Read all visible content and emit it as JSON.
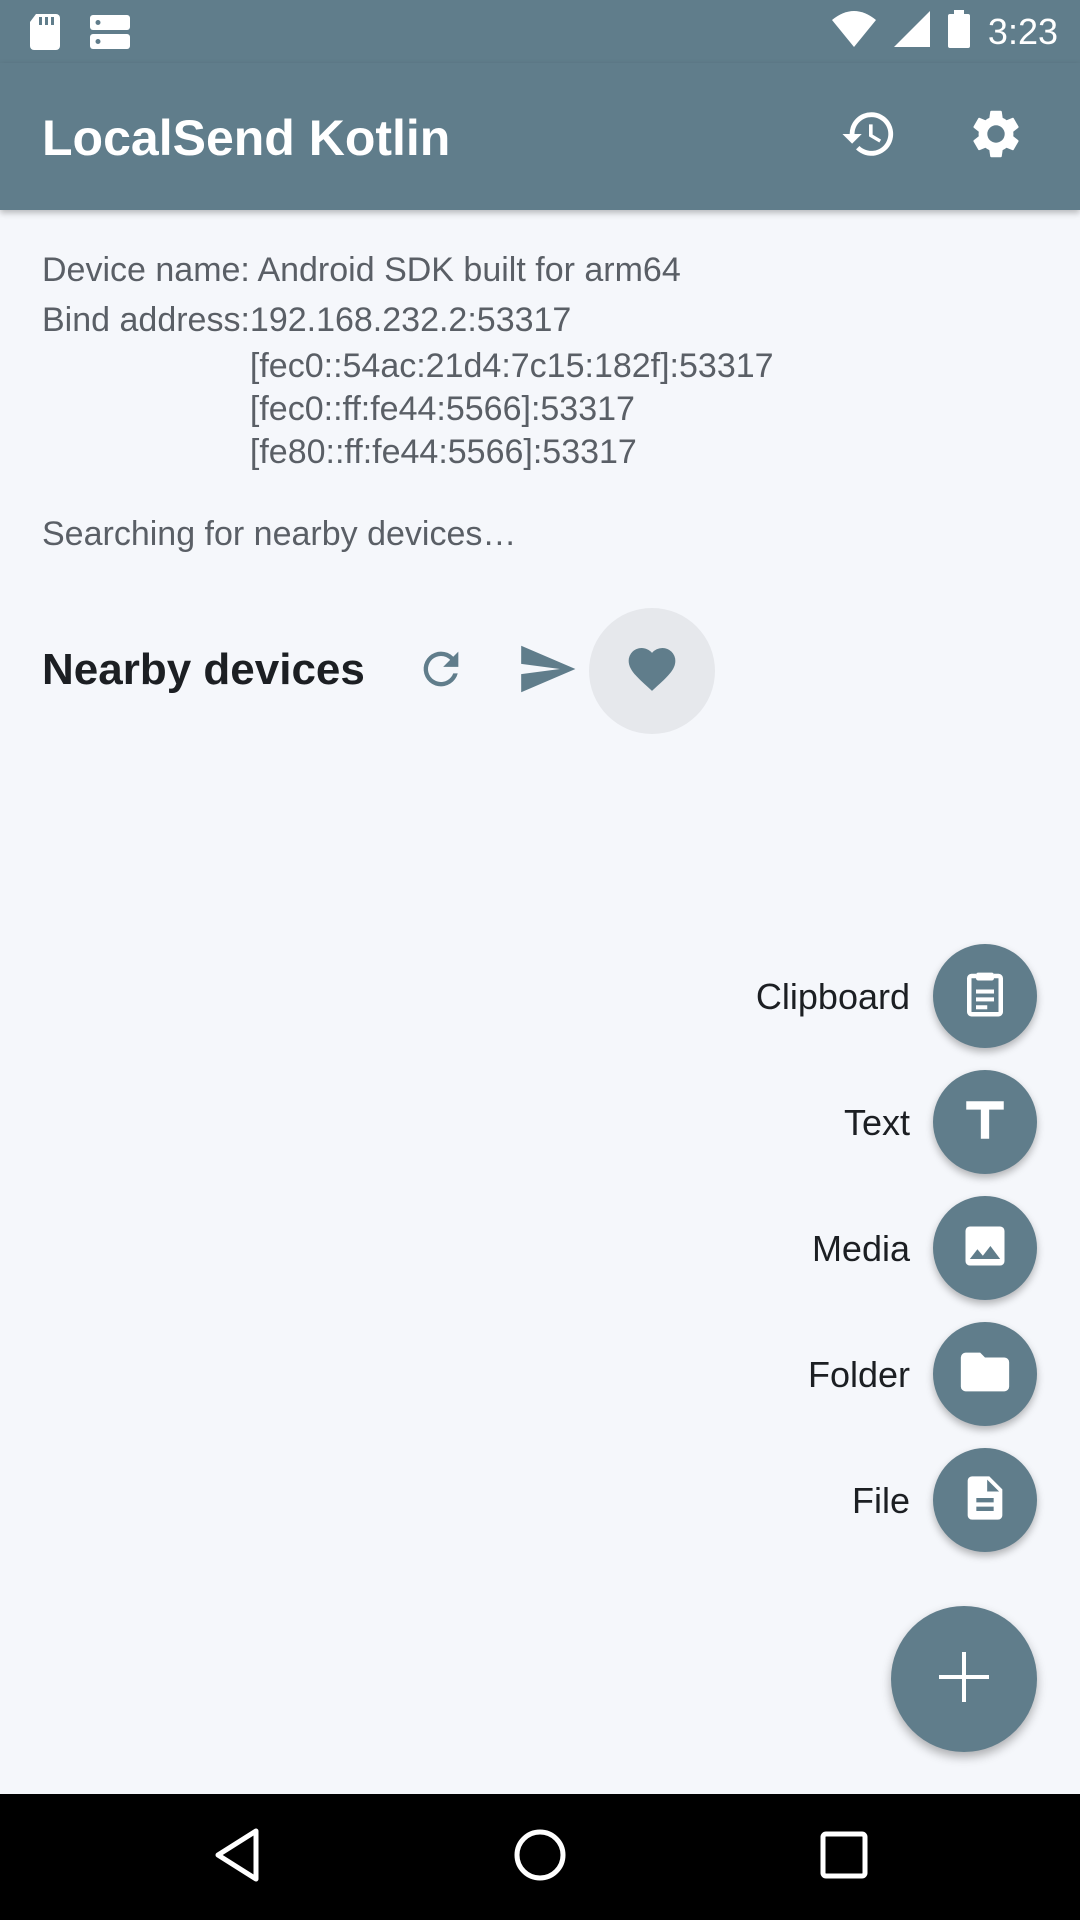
{
  "status_bar": {
    "time": "3:23",
    "icons": [
      "sd-card-icon",
      "storage-icon",
      "wifi-icon",
      "signal-icon",
      "battery-icon"
    ]
  },
  "app_bar": {
    "title": "LocalSend Kotlin",
    "actions": [
      "history-icon",
      "settings-icon"
    ]
  },
  "info": {
    "device_name": "Device name: Android SDK built for arm64",
    "bind_label": "Bind address:",
    "bind_addresses": [
      "192.168.232.2:53317",
      "[fec0::54ac:21d4:7c15:182f]:53317",
      "[fec0::ff:fe44:5566]:53317",
      "[fe80::ff:fe44:5566]:53317"
    ]
  },
  "status": "Searching for nearby devices…",
  "nearby": {
    "title": "Nearby devices",
    "actions": [
      "refresh-icon",
      "send-icon",
      "favorite-icon"
    ]
  },
  "speed_dial": {
    "items": [
      {
        "label": "Clipboard",
        "icon": "clipboard-icon"
      },
      {
        "label": "Text",
        "icon": "text-icon"
      },
      {
        "label": "Media",
        "icon": "image-icon"
      },
      {
        "label": "Folder",
        "icon": "folder-icon"
      },
      {
        "label": "File",
        "icon": "file-icon"
      }
    ],
    "main_icon": "plus-icon"
  },
  "nav_bar": [
    "back-icon",
    "home-icon",
    "recents-icon"
  ],
  "colors": {
    "primary": "#607d8b",
    "background": "#f5f7fb",
    "text": "#1c1f23",
    "secondary_text": "#5a5f66"
  }
}
